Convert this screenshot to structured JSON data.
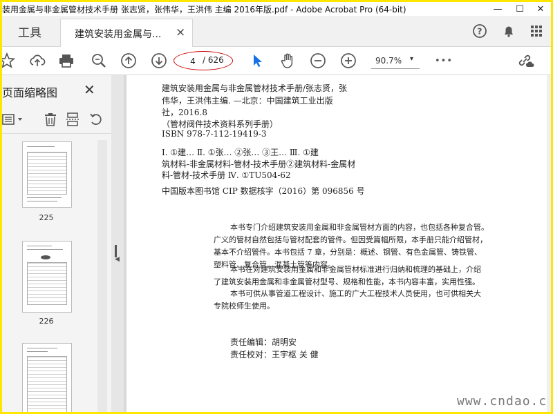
{
  "window": {
    "title": "装用金属与非金属管材技术手册 张志贤，张伟华，王洪伟 主编 2016年版.pdf - Adobe Acrobat Pro (64-bit)",
    "minimize": "—",
    "maximize": "☐",
    "close": "✕"
  },
  "tabs": {
    "tools_label": "工具",
    "doc_tab_label": "建筑安装用金属与...",
    "doc_tab_close": "×"
  },
  "toolbar": {
    "page_current": "4",
    "page_total": "/ 626",
    "zoom": "90.7%",
    "zoom_arrow": "▾",
    "more": "•••"
  },
  "left_panel": {
    "title": "页面缩略图",
    "close": "✕",
    "thumbnails": [
      {
        "label": "225"
      },
      {
        "label": "226"
      },
      {
        "label": ""
      }
    ]
  },
  "document": {
    "cip_lines": [
      "建筑安装用金属与非金属管材技术手册/张志贤，张",
      "伟华，王洪伟主编. —北京：中国建筑工业出版",
      "社，2016.8",
      "（管材阀件技术资料系列手册）",
      "ISBN 978-7-112-19419-3",
      "Ⅰ. ①建…  Ⅱ. ①张… ②张… ③王…  Ⅲ. ①建",
      "筑材料-非金属材料-管材-技术手册②建筑材料-金属材",
      "料-管材-技术手册  Ⅳ. ①TU504-62",
      "中国版本图书馆 CIP 数据核字（2016）第 096856 号"
    ],
    "description_lines": [
      "本书专门介绍建筑安装用金属和非金属管材方面的内容，也包括各种复合管。",
      "广义的管材自然包括与管材配套的管件。但因受篇幅所限，本手册只能介绍管材，",
      "基本不介绍管件。本书包括 7 章，分别是：概述、钢管、有色金属管、铸铁管、",
      "塑料管、复合管、混凝土管等内容。",
      "本书在对建筑安装用金属和非金属管材标准进行归纳和梳理的基础上，介绍",
      "了建筑安装用金属和非金属管材型号、规格和性能，本书内容丰富，实用性强。",
      "本书可供从事管道工程设计、施工的广大工程技术人员使用，也可供相关大",
      "专院校师生使用。"
    ],
    "editor_line": "责任编辑：胡明安",
    "proof_line": "责任校对：王宇枢  关  健",
    "site_watermark": "www.cndao.com"
  },
  "colors": {
    "border": "#ffe600",
    "accent": "#1473e6",
    "page_highlight": "#cc0000"
  }
}
